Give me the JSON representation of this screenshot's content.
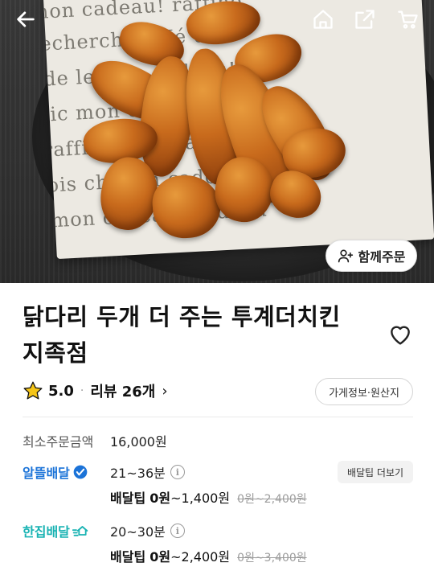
{
  "header": {
    "back_icon": "arrow-left-icon",
    "home_icon": "home-icon",
    "share_icon": "share-icon",
    "cart_icon": "cart-icon"
  },
  "group_order": {
    "label": "함께주문",
    "icon": "person-add-icon"
  },
  "store": {
    "name_line1": "닭다리 두개 더 주는 투계더치킨",
    "name_line2": "지족점",
    "rating": "5.0",
    "review_label": "리뷰 26개",
    "store_info_button": "가게정보·원산지"
  },
  "min_order": {
    "label": "최소주문금액",
    "value": "16,000원"
  },
  "delivery_saver": {
    "brand": "알뜰배달",
    "time": "21~36분",
    "tip_label": "배달팁",
    "tip_zero": "0원",
    "tip_range_rest": "~1,400원",
    "tip_original": "0원~2,400원",
    "more_button": "배달팁 더보기"
  },
  "delivery_single": {
    "brand": "한집배달",
    "time": "20~30분",
    "tip_label": "배달팁",
    "tip_zero": "0원",
    "tip_range_rest": "~2,400원",
    "tip_original": "0원~3,400원"
  },
  "colors": {
    "saver_blue": "#1b73d8",
    "single_teal": "#19b3b3",
    "star_yellow": "#f5c518"
  }
}
